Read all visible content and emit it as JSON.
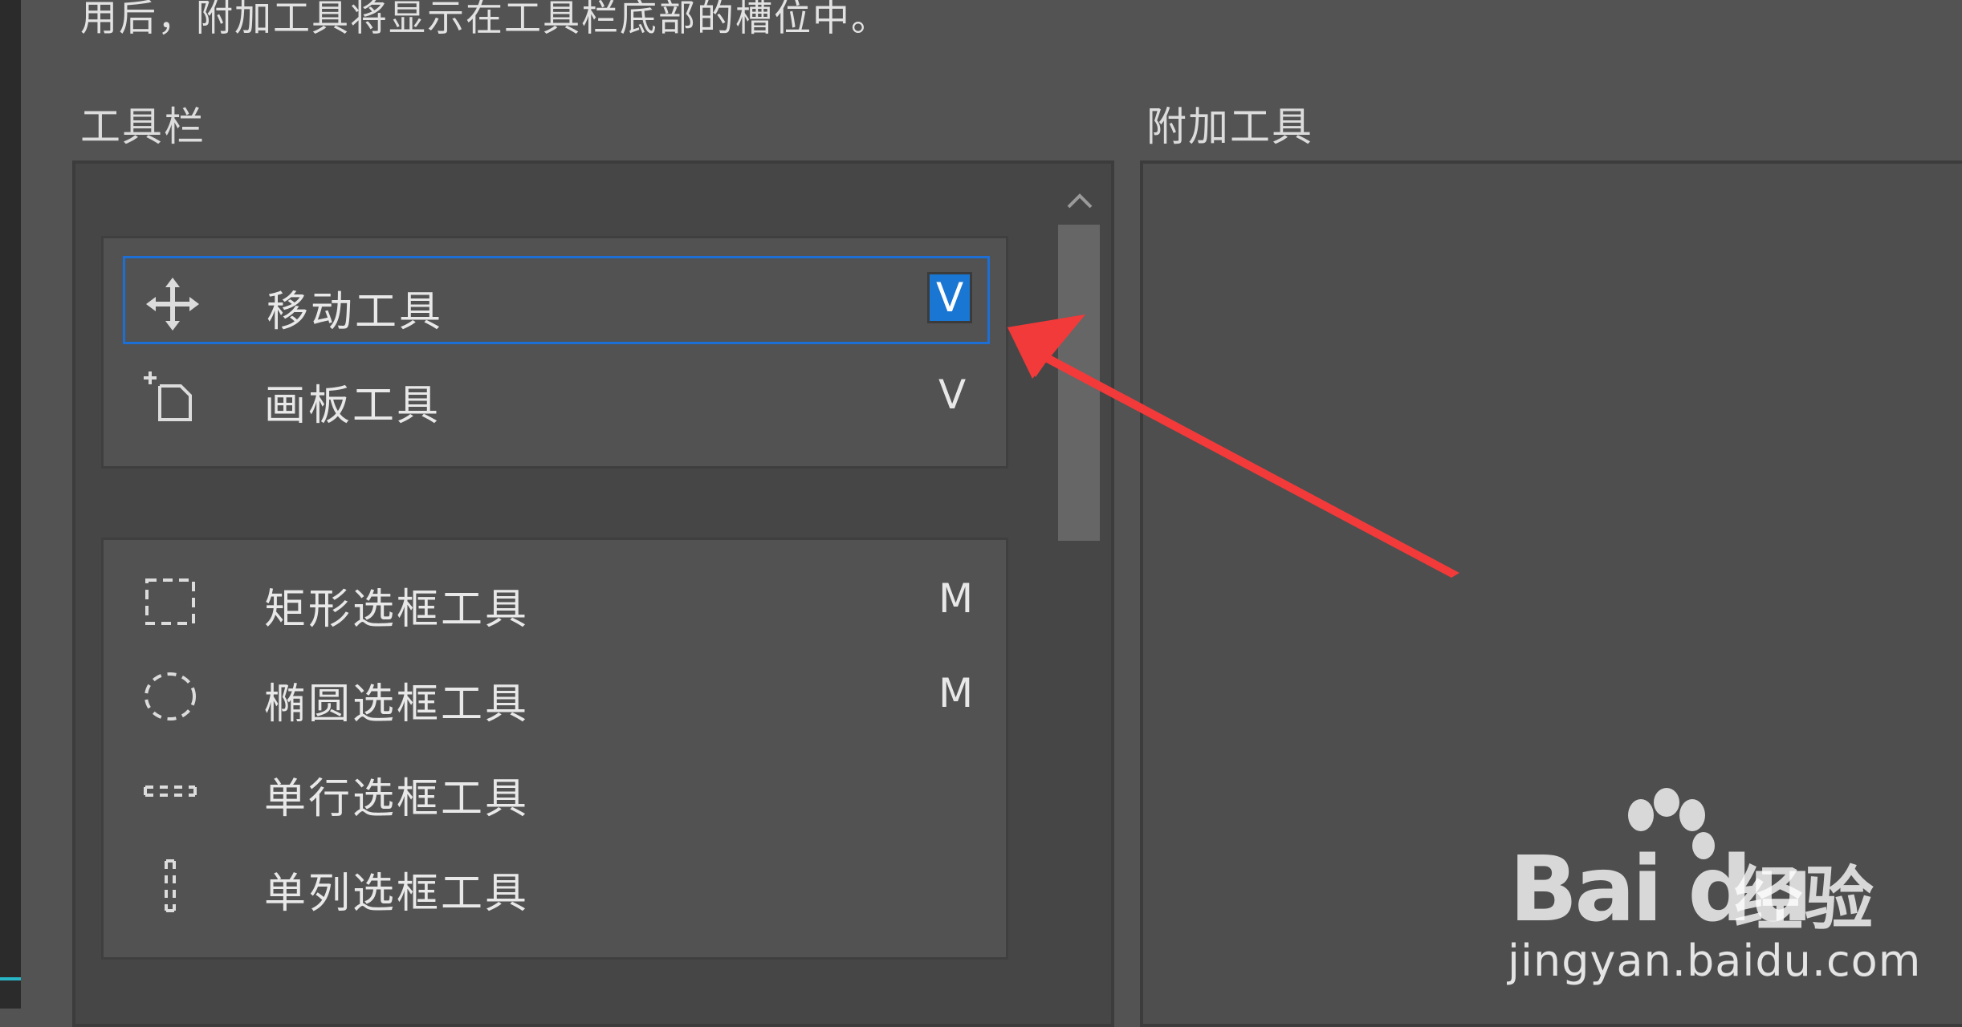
{
  "instruction": "用后，附加工具将显示在工具栏底部的槽位中。",
  "sections": {
    "toolbar_label": "工具栏",
    "extra_tools_label": "附加工具"
  },
  "toolbar": {
    "groups": [
      {
        "tools": [
          {
            "label": "移动工具",
            "shortcut": "V",
            "icon": "move-icon",
            "selected": true
          },
          {
            "label": "画板工具",
            "shortcut": "V",
            "icon": "artboard-icon",
            "selected": false
          }
        ]
      },
      {
        "tools": [
          {
            "label": "矩形选框工具",
            "shortcut": "M",
            "icon": "rectangular-marquee-icon"
          },
          {
            "label": "椭圆选框工具",
            "shortcut": "M",
            "icon": "elliptical-marquee-icon"
          },
          {
            "label": "单行选框工具",
            "shortcut": "",
            "icon": "single-row-marquee-icon"
          },
          {
            "label": "单列选框工具",
            "shortcut": "",
            "icon": "single-column-marquee-icon"
          }
        ]
      }
    ]
  },
  "colors": {
    "background": "#535353",
    "selection_border": "#1d6fd6",
    "shortcut_highlight": "#1976d2",
    "annotation_arrow": "#f23a3a"
  },
  "watermark": {
    "brand": "Bai du",
    "cn": "经验",
    "url": "jingyan.baidu.com"
  }
}
